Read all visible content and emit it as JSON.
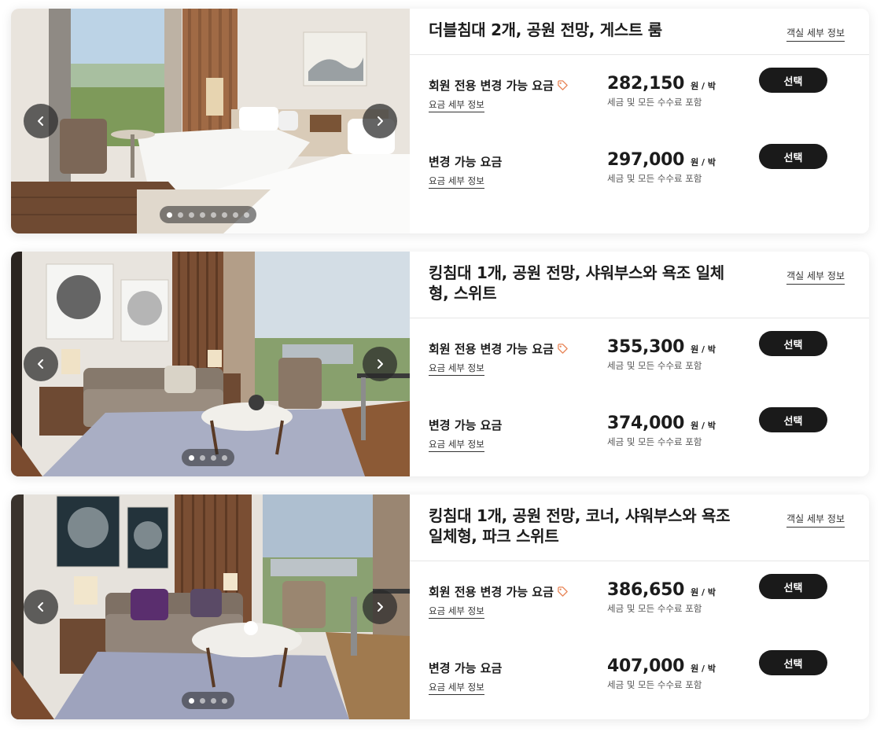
{
  "rooms": [
    {
      "title": "더블침대 2개, 공원 전망, 게스트 룸",
      "room_detail_link": "객실 세부 정보",
      "gallery": {
        "total_images": 8,
        "current_image": 1
      },
      "rates": [
        {
          "name": "회원 전용 변경 가능 요금",
          "member_tag": true,
          "detail_link": "요금 세부 정보",
          "price": "282,150",
          "unit": "원 / 박",
          "note": "세금 및 모든 수수료 포함",
          "button": "선택"
        },
        {
          "name": "변경 가능 요금",
          "member_tag": false,
          "detail_link": "요금 세부 정보",
          "price": "297,000",
          "unit": "원 / 박",
          "note": "세금 및 모든 수수료 포함",
          "button": "선택"
        }
      ]
    },
    {
      "title": "킹침대 1개, 공원 전망, 샤워부스와 욕조 일체형, 스위트",
      "room_detail_link": "객실 세부 정보",
      "gallery": {
        "total_images": 4,
        "current_image": 1
      },
      "rates": [
        {
          "name": "회원 전용 변경 가능 요금",
          "member_tag": true,
          "detail_link": "요금 세부 정보",
          "price": "355,300",
          "unit": "원 / 박",
          "note": "세금 및 모든 수수료 포함",
          "button": "선택"
        },
        {
          "name": "변경 가능 요금",
          "member_tag": false,
          "detail_link": "요금 세부 정보",
          "price": "374,000",
          "unit": "원 / 박",
          "note": "세금 및 모든 수수료 포함",
          "button": "선택"
        }
      ]
    },
    {
      "title": "킹침대 1개, 공원 전망, 코너, 샤워부스와 욕조 일체형, 파크 스위트",
      "room_detail_link": "객실 세부 정보",
      "gallery": {
        "total_images": 4,
        "current_image": 1
      },
      "rates": [
        {
          "name": "회원 전용 변경 가능 요금",
          "member_tag": true,
          "detail_link": "요금 세부 정보",
          "price": "386,650",
          "unit": "원 / 박",
          "note": "세금 및 모든 수수료 포함",
          "button": "선택"
        },
        {
          "name": "변경 가능 요금",
          "member_tag": false,
          "detail_link": "요금 세부 정보",
          "price": "407,000",
          "unit": "원 / 박",
          "note": "세금 및 모든 수수료 포함",
          "button": "선택"
        }
      ]
    }
  ],
  "icons": {
    "prev": "chevron-left-icon",
    "next": "chevron-right-icon",
    "member_tag": "price-tag-icon"
  },
  "colors": {
    "button_bg": "#1a1a1a",
    "button_text": "#ffffff",
    "tag_accent": "#e8875a"
  }
}
